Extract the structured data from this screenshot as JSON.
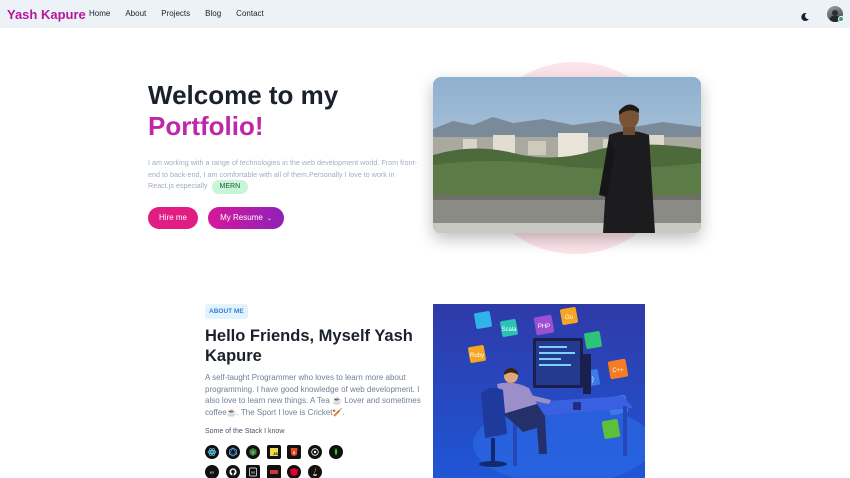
{
  "nav": {
    "brand": "Yash Kapure",
    "links": [
      "Home",
      "About",
      "Projects",
      "Blog",
      "Contact"
    ],
    "icons": {
      "theme": "moon-icon",
      "profile": "avatar"
    }
  },
  "hero": {
    "title_line1": "Welcome to my",
    "title_line2": "Portfolio!",
    "description": "I am working with a range of technologies in the web development world. From front-end to back-end, I am comfortable with all of them.Personally I love to work in React.js especially",
    "badge": "MERN",
    "hire_button": "Hire me",
    "resume_button": "My Resume"
  },
  "about": {
    "badge": "ABOUT ME",
    "heading": "Hello Friends, Myself Yash Kapure",
    "text": "A self-taught Programmer who loves to learn more about programming. I have good knowledge of web development. I also love to learn new things. A Tea ☕ Lover and sometimes coffee☕. The Sport I love is Cricket🏏.",
    "stack_label": "Some of the Stack I know",
    "stack_icons_row1": [
      "react-icon",
      "graphql-icon",
      "node-icon",
      "javascript-icon",
      "html5-icon",
      "redux-icon",
      "mongodb-icon"
    ],
    "stack_icons_row2": [
      "nextjs-icon",
      "github-icon",
      "heroku-icon",
      "npm-icon",
      "angular-icon",
      "java-icon"
    ]
  },
  "colors": {
    "brand": "#b5179e",
    "accent_pink": "#e11d84",
    "accent_purple": "#8e22b8",
    "nav_bg": "#edf2f7",
    "badge_green": "#c6f6d5"
  }
}
